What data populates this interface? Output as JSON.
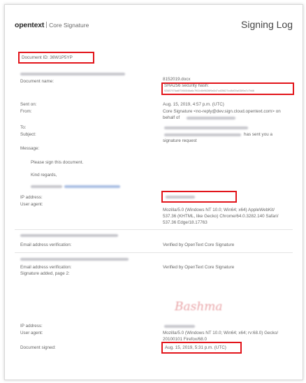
{
  "header": {
    "brand": "opentext",
    "product": "Core Signature",
    "title": "Signing Log"
  },
  "document_id": "Document ID: 36W1P5YP",
  "labels": {
    "document_name": "Document name:",
    "sent_on": "Sent on:",
    "from": "From:",
    "to": "To:",
    "subject": "Subject:",
    "message": "Message:",
    "ip_address": "IP address:",
    "user_agent": "User agent:",
    "email_verification": "Email address verification:",
    "signature_added": "Signature added, page 2:",
    "document_signed": "Document signed:"
  },
  "values": {
    "file_name": "8152019.docx",
    "hash_label": "SHA256 security hash:",
    "hash_value": "92887976a6f7066546a6c7f61b8b9636f9a5d7cd35627cd8d00a0389a7c7b66",
    "sent_on": "Aug. 15, 2019, 4:57 p.m. (UTC)",
    "from_line1": "Core Signature <no-reply@dev.sign.cloud.opentext.com> on",
    "from_line2": "behalf of",
    "subject_tail": "has sent you a",
    "subject_line2": "signature request",
    "message_line1": "Please sign this document.",
    "message_line2": "Kind regards,",
    "ua1_line1": "Mozilla/5.0 (Windows NT 10.0; Win64; x64) AppleWebKit/",
    "ua1_line2": "537.36 (KHTML, like Gecko) Chrome/64.0.3282.140 Safari/",
    "ua1_line3": "537.36 Edge/18.17763",
    "verified1": "Verified by OpenText Core Signature",
    "verified2": "Verified by OpenText Core Signature",
    "ua2_line1": "Mozilla/5.0 (Windows NT 10.0; Win64; x64; rv:68.0) Gecko/",
    "ua2_line2": "20100101 Firefox/68.0",
    "document_signed": "Aug. 15, 2019, 5:31 p.m. (UTC)"
  },
  "signature_text": "Bashma",
  "colors": {
    "highlight_red": "#e2141a",
    "redacted_gray": "#c6c6cc",
    "redacted_blue": "#a9bee3",
    "signature_pink": "#e9a5a8"
  }
}
